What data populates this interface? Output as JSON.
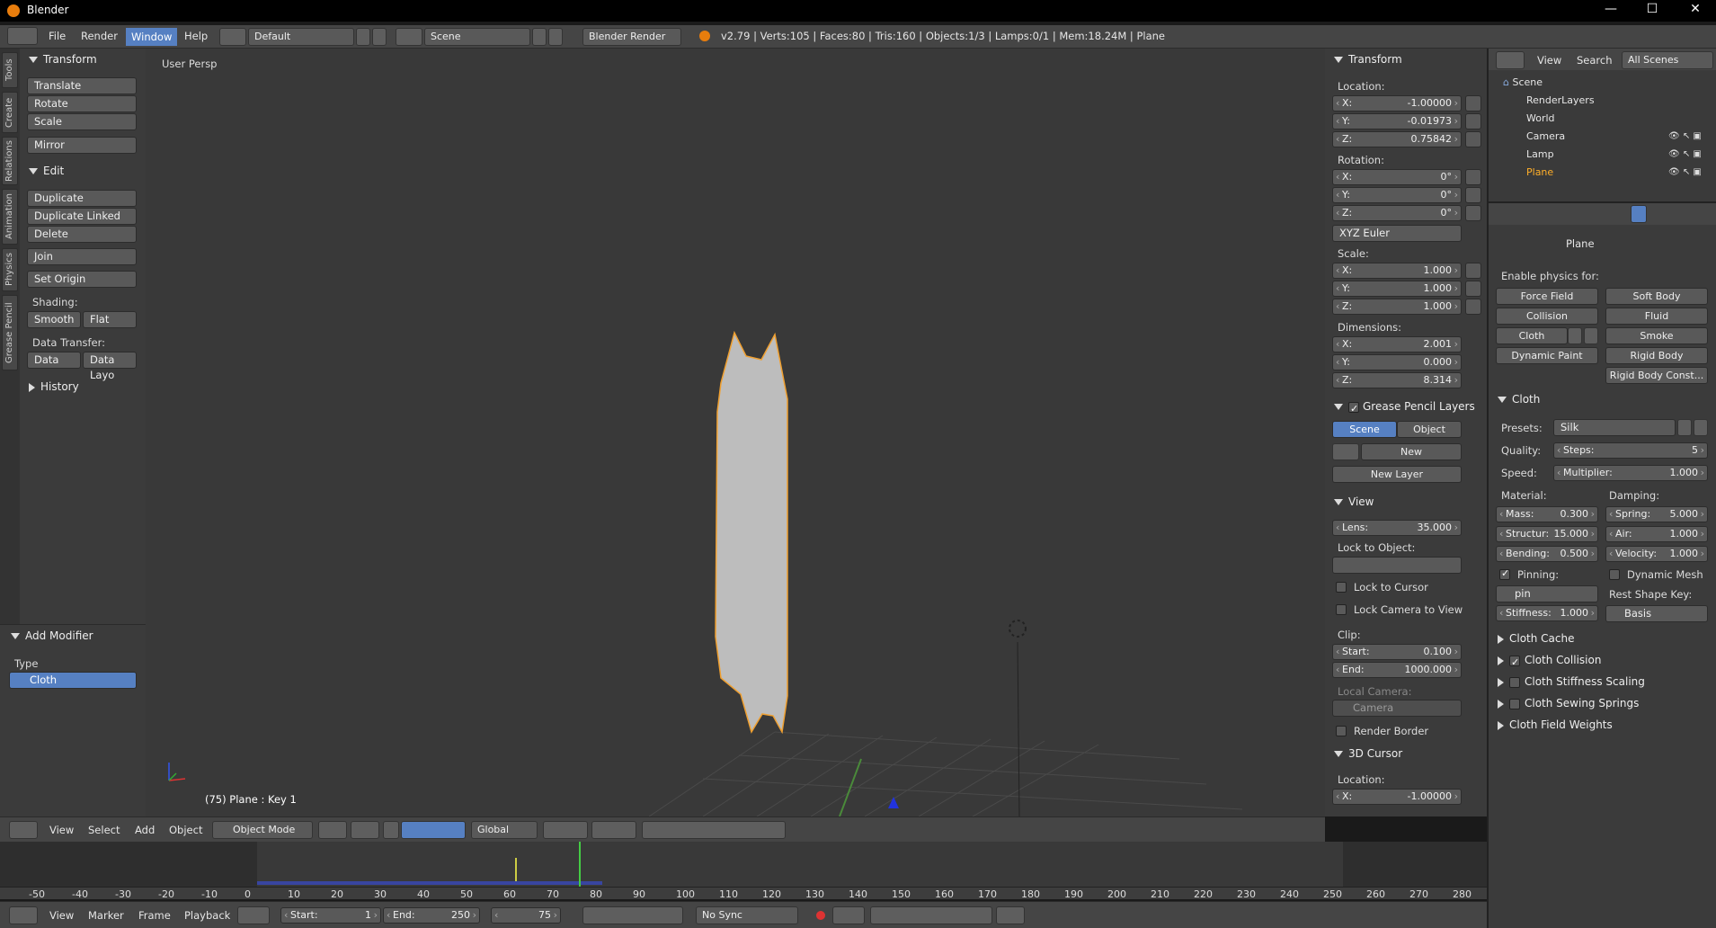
{
  "window": {
    "title": "Blender"
  },
  "menu": {
    "file": "File",
    "render": "Render",
    "window": "Window",
    "help": "Help"
  },
  "layout": {
    "screen": "Default",
    "scene": "Scene",
    "engine": "Blender Render"
  },
  "stats": "v2.79 | Verts:105 | Faces:80 | Tris:160 | Objects:1/3 | Lamps:0/1 | Mem:18.24M | Plane",
  "tabs": [
    "Tools",
    "Create",
    "Relations",
    "Animation",
    "Physics",
    "Grease Pencil"
  ],
  "tools": {
    "transform_title": "Transform",
    "translate": "Translate",
    "rotate": "Rotate",
    "scale": "Scale",
    "mirror": "Mirror",
    "edit_title": "Edit",
    "duplicate": "Duplicate",
    "duplicate_linked": "Duplicate Linked",
    "delete": "Delete",
    "join": "Join",
    "set_origin": "Set Origin",
    "shading_label": "Shading:",
    "smooth": "Smooth",
    "flat": "Flat",
    "data_transfer_label": "Data Transfer:",
    "data": "Data",
    "data_layout": "Data Layo",
    "history": "History"
  },
  "operator": {
    "title": "Add Modifier",
    "type_label": "Type",
    "type_value": "Cloth"
  },
  "viewport": {
    "view_name": "User Persp",
    "object_info": "(75) Plane : Key 1"
  },
  "view3d_header": {
    "view": "View",
    "select": "Select",
    "add": "Add",
    "object": "Object",
    "mode": "Object Mode",
    "orientation": "Global"
  },
  "npanel": {
    "transform_title": "Transform",
    "location_label": "Location:",
    "loc": [
      {
        "k": "X:",
        "v": "-1.00000"
      },
      {
        "k": "Y:",
        "v": "-0.01973"
      },
      {
        "k": "Z:",
        "v": "0.75842"
      }
    ],
    "rotation_label": "Rotation:",
    "rot": [
      {
        "k": "X:",
        "v": "0°"
      },
      {
        "k": "Y:",
        "v": "0°"
      },
      {
        "k": "Z:",
        "v": "0°"
      }
    ],
    "rotation_mode": "XYZ Euler",
    "scale_label": "Scale:",
    "scl": [
      {
        "k": "X:",
        "v": "1.000"
      },
      {
        "k": "Y:",
        "v": "1.000"
      },
      {
        "k": "Z:",
        "v": "1.000"
      }
    ],
    "dimensions_label": "Dimensions:",
    "dim": [
      {
        "k": "X:",
        "v": "2.001"
      },
      {
        "k": "Y:",
        "v": "0.000"
      },
      {
        "k": "Z:",
        "v": "8.314"
      }
    ],
    "gp_title": "Grease Pencil Layers",
    "gp_scene": "Scene",
    "gp_object": "Object",
    "gp_new": "New",
    "gp_new_layer": "New Layer",
    "view_title": "View",
    "lens_k": "Lens:",
    "lens_v": "35.000",
    "lock_object_label": "Lock to Object:",
    "lock_cursor": "Lock to Cursor",
    "lock_camera": "Lock Camera to View",
    "clip_label": "Clip:",
    "clip_start_k": "Start:",
    "clip_start_v": "0.100",
    "clip_end_k": "End:",
    "clip_end_v": "1000.000",
    "local_camera_label": "Local Camera:",
    "local_camera_value": "Camera",
    "render_border": "Render Border",
    "cursor_title": "3D Cursor",
    "cursor_location_label": "Location:",
    "cursor_x_k": "X:",
    "cursor_x_v": "-1.00000"
  },
  "outliner": {
    "view": "View",
    "search": "Search",
    "filter": "All Scenes",
    "items": [
      "Scene",
      "RenderLayers",
      "World",
      "Camera",
      "Lamp",
      "Plane"
    ]
  },
  "properties": {
    "breadcrumb": "Plane",
    "enable_physics": "Enable physics for:",
    "force_field": "Force Field",
    "soft_body": "Soft Body",
    "collision": "Collision",
    "fluid": "Fluid",
    "cloth": "Cloth",
    "smoke": "Smoke",
    "dynamic_paint": "Dynamic Paint",
    "rigid_body": "Rigid Body",
    "rigid_body_const": "Rigid Body Const...",
    "cloth_title": "Cloth",
    "presets_label": "Presets:",
    "presets_value": "Silk",
    "quality_label": "Quality:",
    "steps_k": "Steps:",
    "steps_v": "5",
    "speed_label": "Speed:",
    "mult_k": "Multiplier:",
    "mult_v": "1.000",
    "material_label": "Material:",
    "damping_label": "Damping:",
    "mass_k": "Mass:",
    "mass_v": "0.300",
    "spring_k": "Spring:",
    "spring_v": "5.000",
    "struct_k": "Structur:",
    "struct_v": "15.000",
    "air_k": "Air:",
    "air_v": "1.000",
    "bend_k": "Bending:",
    "bend_v": "0.500",
    "vel_k": "Velocity:",
    "vel_v": "1.000",
    "pinning": "Pinning:",
    "dynamic_mesh": "Dynamic Mesh",
    "pin_group": "pin",
    "rest_shape_label": "Rest Shape Key:",
    "stiff_k": "Stiffness:",
    "stiff_v": "1.000",
    "basis": "Basis",
    "sub_cache": "Cloth Cache",
    "sub_collision": "Cloth Collision",
    "sub_stiffness": "Cloth Stiffness Scaling",
    "sub_sewing": "Cloth Sewing Springs",
    "sub_field": "Cloth Field Weights"
  },
  "timeline": {
    "ticks": [
      "-50",
      "-40",
      "-30",
      "-20",
      "-10",
      "0",
      "10",
      "20",
      "30",
      "40",
      "50",
      "60",
      "70",
      "80",
      "90",
      "100",
      "110",
      "120",
      "130",
      "140",
      "150",
      "160",
      "170",
      "180",
      "190",
      "200",
      "210",
      "220",
      "230",
      "240",
      "250",
      "260",
      "270",
      "280"
    ],
    "view": "View",
    "marker": "Marker",
    "frame": "Frame",
    "playback": "Playback",
    "start_k": "Start:",
    "start_v": "1",
    "end_k": "End:",
    "end_v": "250",
    "current": "75",
    "sync": "No Sync"
  },
  "colors": {
    "accent": "#5680c2",
    "selection": "#f0a030",
    "bg": "#393939"
  }
}
